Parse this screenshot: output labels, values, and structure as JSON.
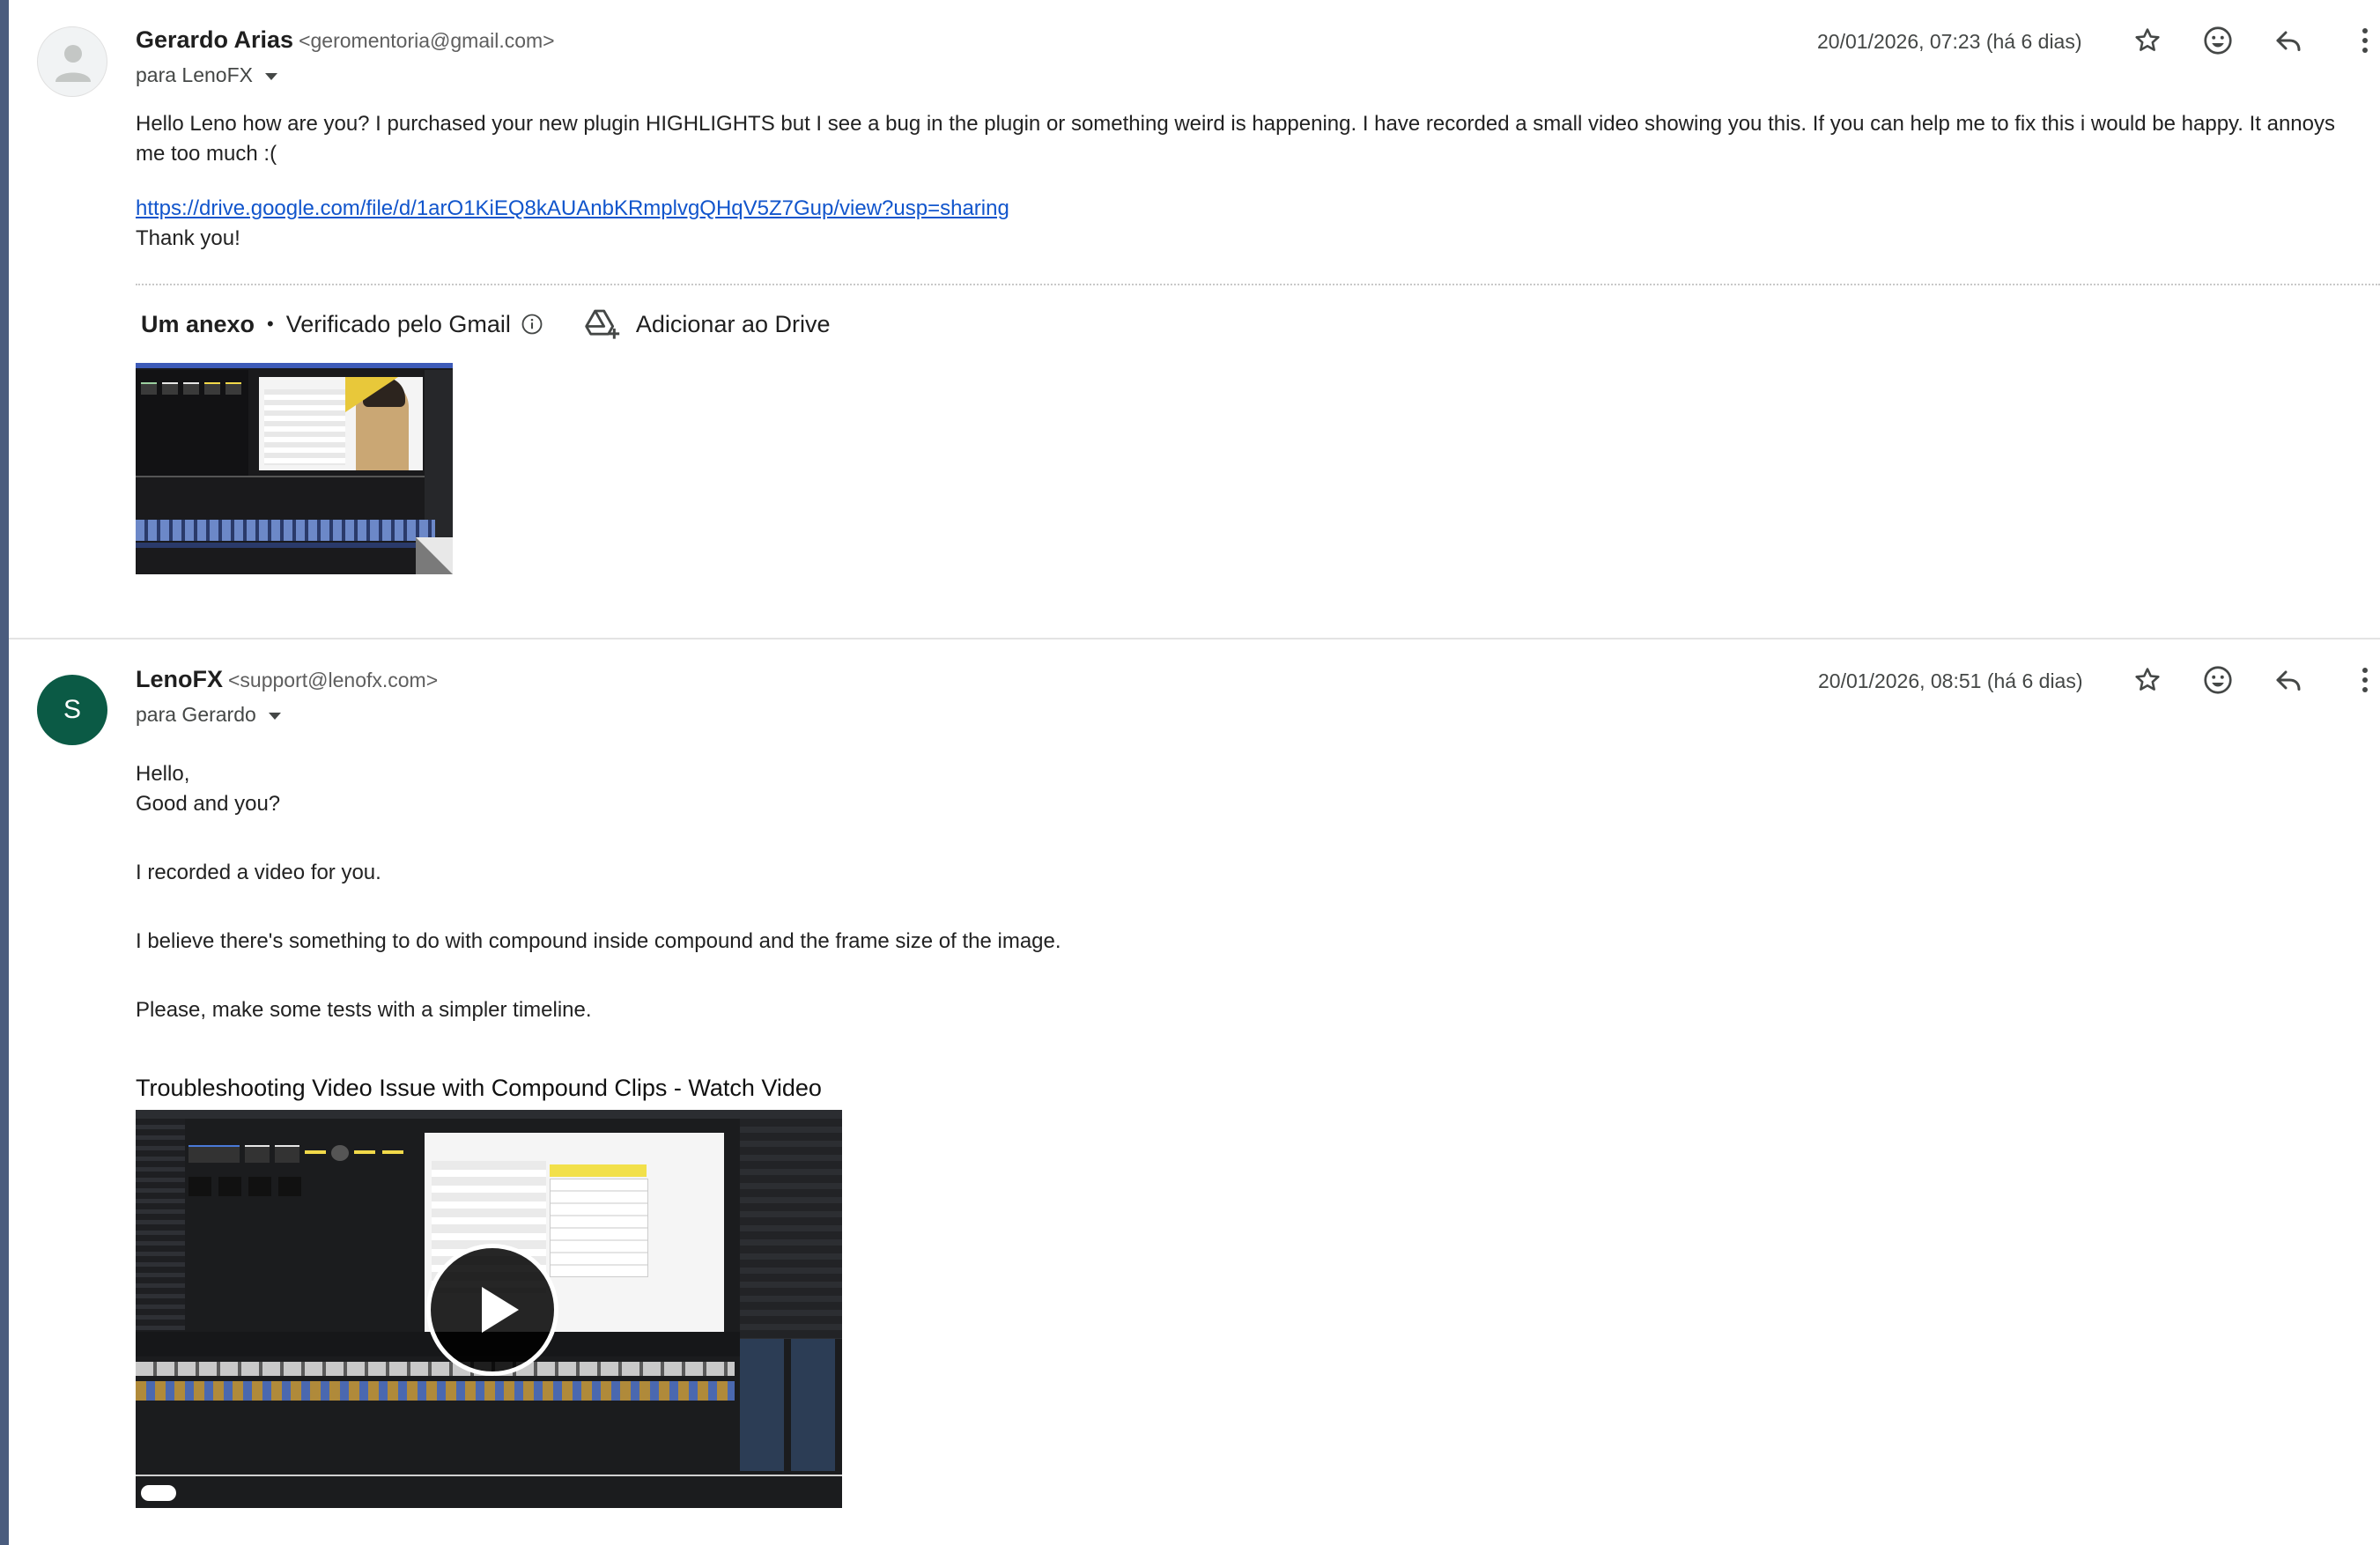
{
  "icons": {
    "star": "star-icon",
    "emoji": "emoji-icon",
    "reply": "reply-icon",
    "more": "more-vert-icon",
    "info": "info-icon",
    "drive": "add-to-drive-icon",
    "avatar_placeholder": "person-icon",
    "play": "play-icon"
  },
  "colors": {
    "link": "#1155cc",
    "avatar_green": "#0b5a45",
    "left_bar": "#4a5c7e"
  },
  "messages": [
    {
      "sender_name": "Gerardo Arias",
      "sender_email": "<geromentoria@gmail.com>",
      "to": "para LenoFX",
      "date": "20/01/2026, 07:23 (há 6 dias)",
      "body": [
        "Hello Leno how are you? I purchased your new plugin HIGHLIGHTS but I see a bug in the plugin or something weird is happening. I have recorded a small video showing you this. If you can help me to fix this i would be happy. It annoys me too much :("
      ],
      "link": "https://drive.google.com/file/d/1arO1KiEQ8kAUAnbKRmplvgQHqV5Z7Gup/view?usp=sharing",
      "closing": "Thank you!",
      "attachments": {
        "count_label": "Um anexo",
        "separator": "•",
        "verified_label": "Verificado pelo Gmail",
        "add_to_drive_label": "Adicionar ao Drive"
      }
    },
    {
      "avatar_letter": "S",
      "sender_name": "LenoFX",
      "sender_email": "<support@lenofx.com>",
      "to": "para Gerardo",
      "date": "20/01/2026, 08:51 (há 6 dias)",
      "body": [
        "Hello,",
        "Good and you?",
        "I recorded a video for you.",
        "I believe there's something to do with compound inside compound and the frame size of the image.",
        "Please, make some tests with a simpler timeline."
      ],
      "video_title": "Troubleshooting Video Issue with Compound Clips - Watch Video"
    }
  ]
}
